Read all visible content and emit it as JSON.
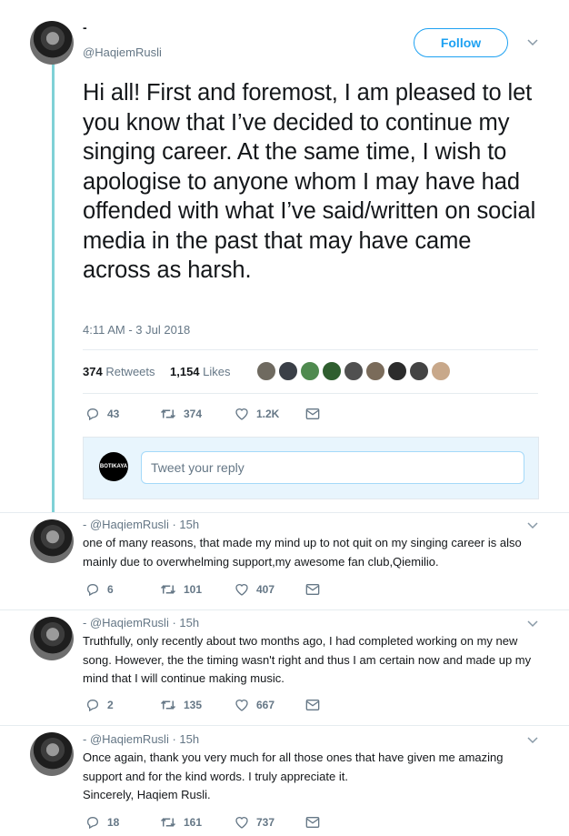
{
  "main_tweet": {
    "display_name": "-",
    "handle": "@HaqiemRusli",
    "follow_label": "Follow",
    "text": "Hi all! First and foremost, I am pleased to let you know that I’ve decided to continue my singing career. At the same time, I wish to apologise to anyone whom I may have had offended with what I’ve said/written on social media in the past that may have came across as harsh.",
    "timestamp": "4:11 AM - 3 Jul 2018",
    "retweets_count": "374",
    "retweets_label": "Retweets",
    "likes_count": "1,154",
    "likes_label": "Likes",
    "actions": {
      "replies": "43",
      "retweets": "374",
      "likes": "1.2K"
    }
  },
  "reply_box": {
    "avatar_text": "BOTIKAYA",
    "placeholder": "Tweet your reply"
  },
  "replies": [
    {
      "header": "- @HaqiemRusli · 15h",
      "text": "one of many reasons, that made my mind up to not quit on my singing career is also mainly due to overwhelming support,my awesome fan club,Qiemilio.",
      "actions": {
        "replies": "6",
        "retweets": "101",
        "likes": "407"
      }
    },
    {
      "header": "- @HaqiemRusli · 15h",
      "text": "Truthfully, only recently about two months ago, I had completed working on my new song. However, the the timing wasn't right and thus I am certain now and made up my mind that I will continue making music.",
      "actions": {
        "replies": "2",
        "retweets": "135",
        "likes": "667"
      }
    },
    {
      "header": "- @HaqiemRusli · 15h",
      "text": "Once again, thank you very much for all those ones that have given me amazing support and for the kind words. I truly appreciate it.\nSincerely, Haqiem Rusli.",
      "actions": {
        "replies": "18",
        "retweets": "161",
        "likes": "737"
      }
    }
  ],
  "icons": [
    "reply-icon",
    "retweet-icon",
    "like-icon",
    "message-icon",
    "chevron-down-icon"
  ],
  "colors": {
    "accent": "#1da1f2",
    "muted": "#657786",
    "thread": "#7fd1d6"
  }
}
